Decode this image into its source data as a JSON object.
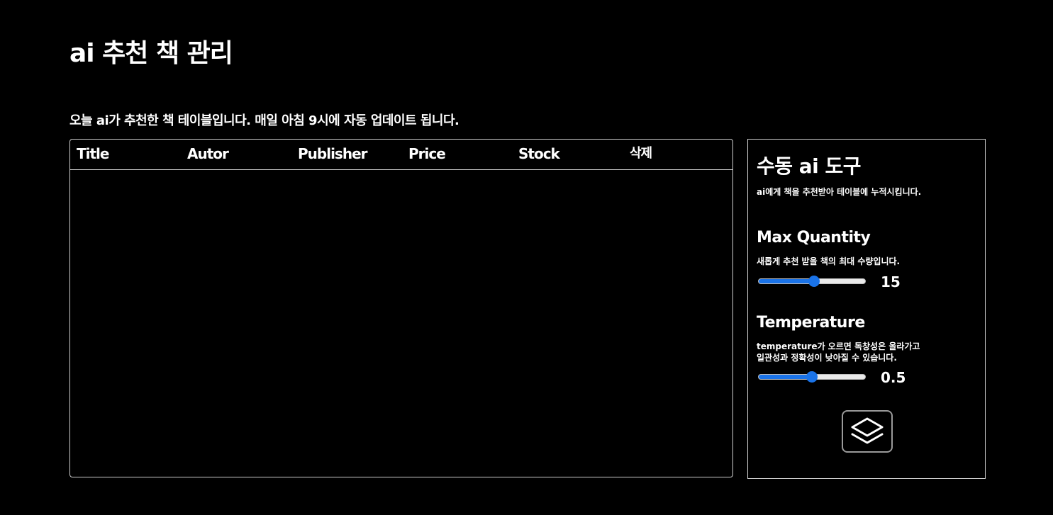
{
  "page": {
    "title": "ai 추천 책 관리",
    "subtitle": "오늘 ai가 추천한 책 테이블입니다. 매일 아침 9시에 자동 업데이트 됩니다."
  },
  "table": {
    "columns": [
      "Title",
      "Autor",
      "Publisher",
      "Price",
      "Stock",
      "삭제"
    ],
    "rows": []
  },
  "panel": {
    "title": "수동 ai 도구",
    "description": "ai에게 책을 추천받아 테이블에 누적시킵니다.",
    "max_quantity": {
      "label": "Max Quantity",
      "description": "새롭게 추천 받을 책의 최대 수량입니다.",
      "value": "15",
      "fraction": 0.52
    },
    "temperature": {
      "label": "Temperature",
      "description_line1": "temperature가 오르면 독창성은 올라가고",
      "description_line2": "일관성과 정확성이 낮아질 수 있습니다.",
      "value": "0.5",
      "fraction": 0.5
    },
    "action_button": {
      "icon": "layers-icon"
    }
  },
  "colors": {
    "background": "#000000",
    "text": "#ffffff",
    "border": "#cfcfcf",
    "accent": "#1a73e8"
  }
}
